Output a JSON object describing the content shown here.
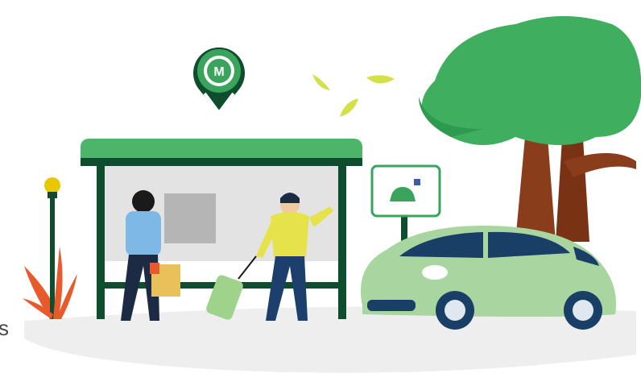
{
  "scene": {
    "description_visible_text": {
      "pin_letter": "M",
      "edge_letter": "s"
    },
    "colors": {
      "brand_green": "#3aa35c",
      "dark_green": "#0f4d2f",
      "car_body": "#a8d5a0",
      "tree_top": "#3fae5e",
      "trunk": "#8a3d1a",
      "leaf_yellow": "#d4e04a",
      "bag": "#e9c15a",
      "ground": "#eeeeee"
    },
    "icons": [
      "location-pin-icon",
      "car-sign-icon",
      "street-lamp",
      "bus-shelter",
      "tree",
      "car",
      "suitcase",
      "shopping-bag",
      "bush"
    ]
  }
}
